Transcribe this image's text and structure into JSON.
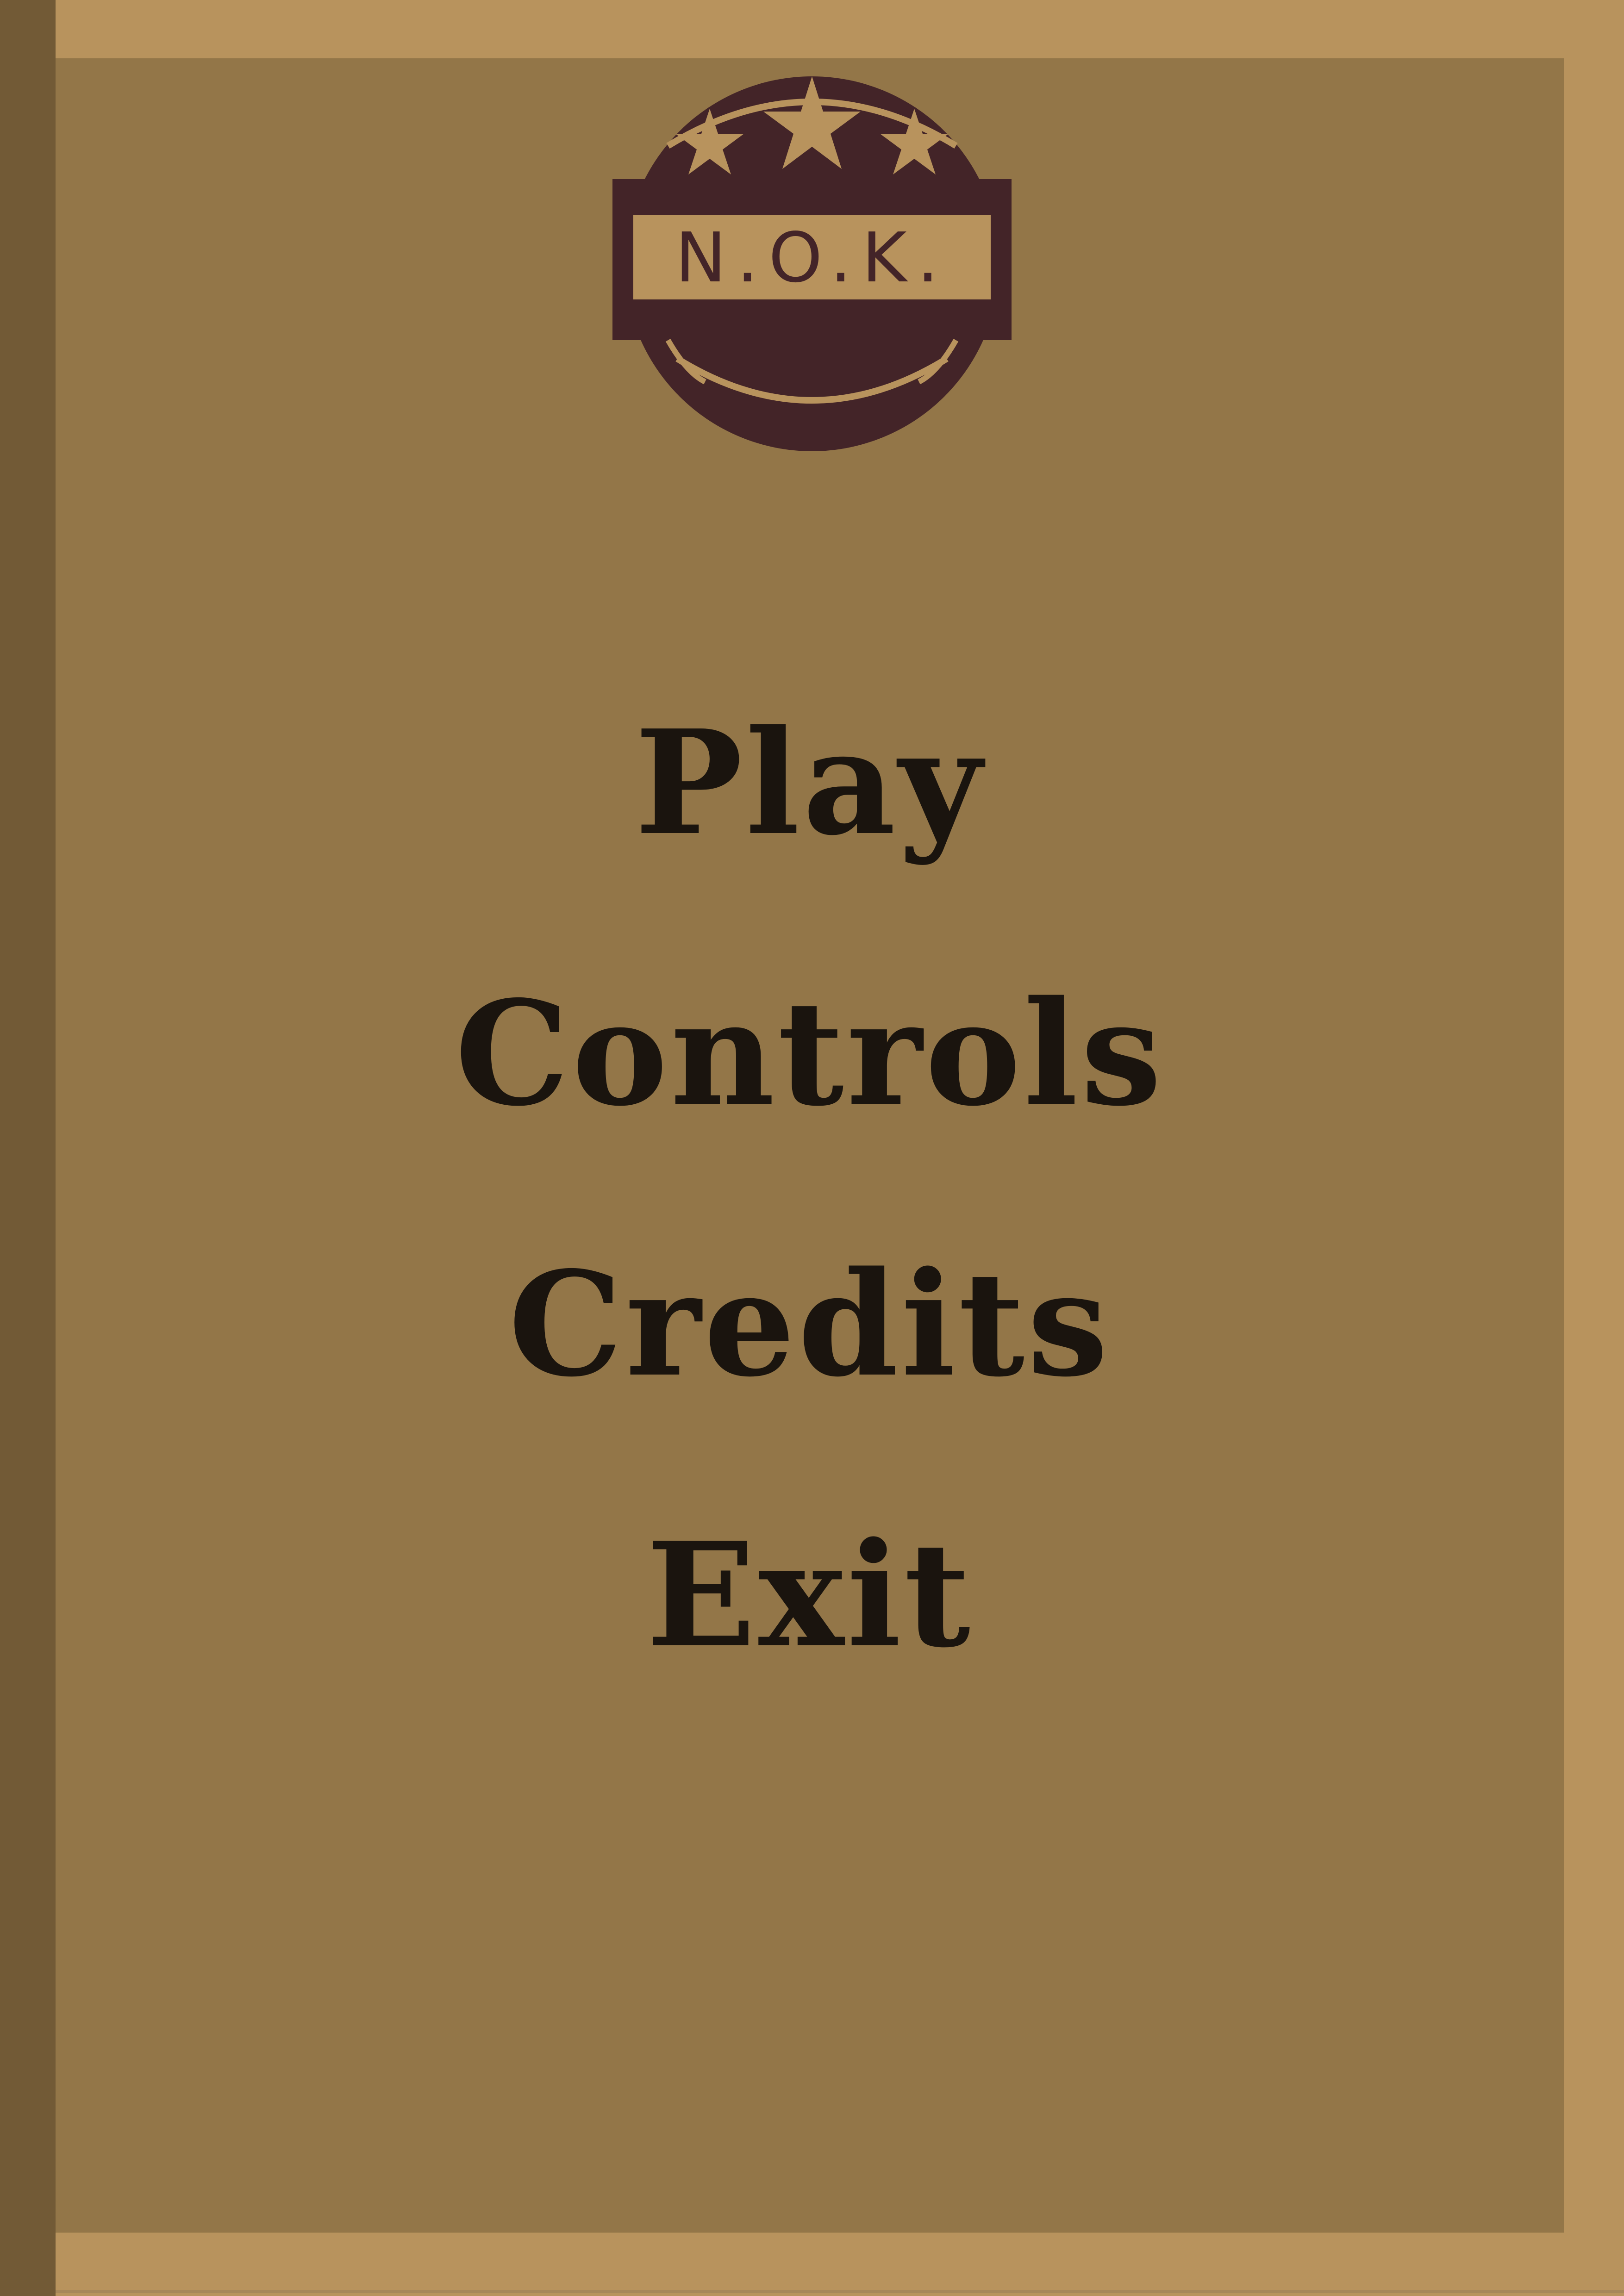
{
  "logo": {
    "text": "N.O.K.",
    "icon": "badge-with-stars-emblem"
  },
  "menu": {
    "items": [
      {
        "label": "Play"
      },
      {
        "label": "Controls"
      },
      {
        "label": "Credits"
      },
      {
        "label": "Exit"
      }
    ]
  },
  "colors": {
    "frame": "#b8935d",
    "panel": "#937648",
    "spine": "#725a36",
    "emblem": "#432428",
    "menu_text": "#1a140e"
  }
}
